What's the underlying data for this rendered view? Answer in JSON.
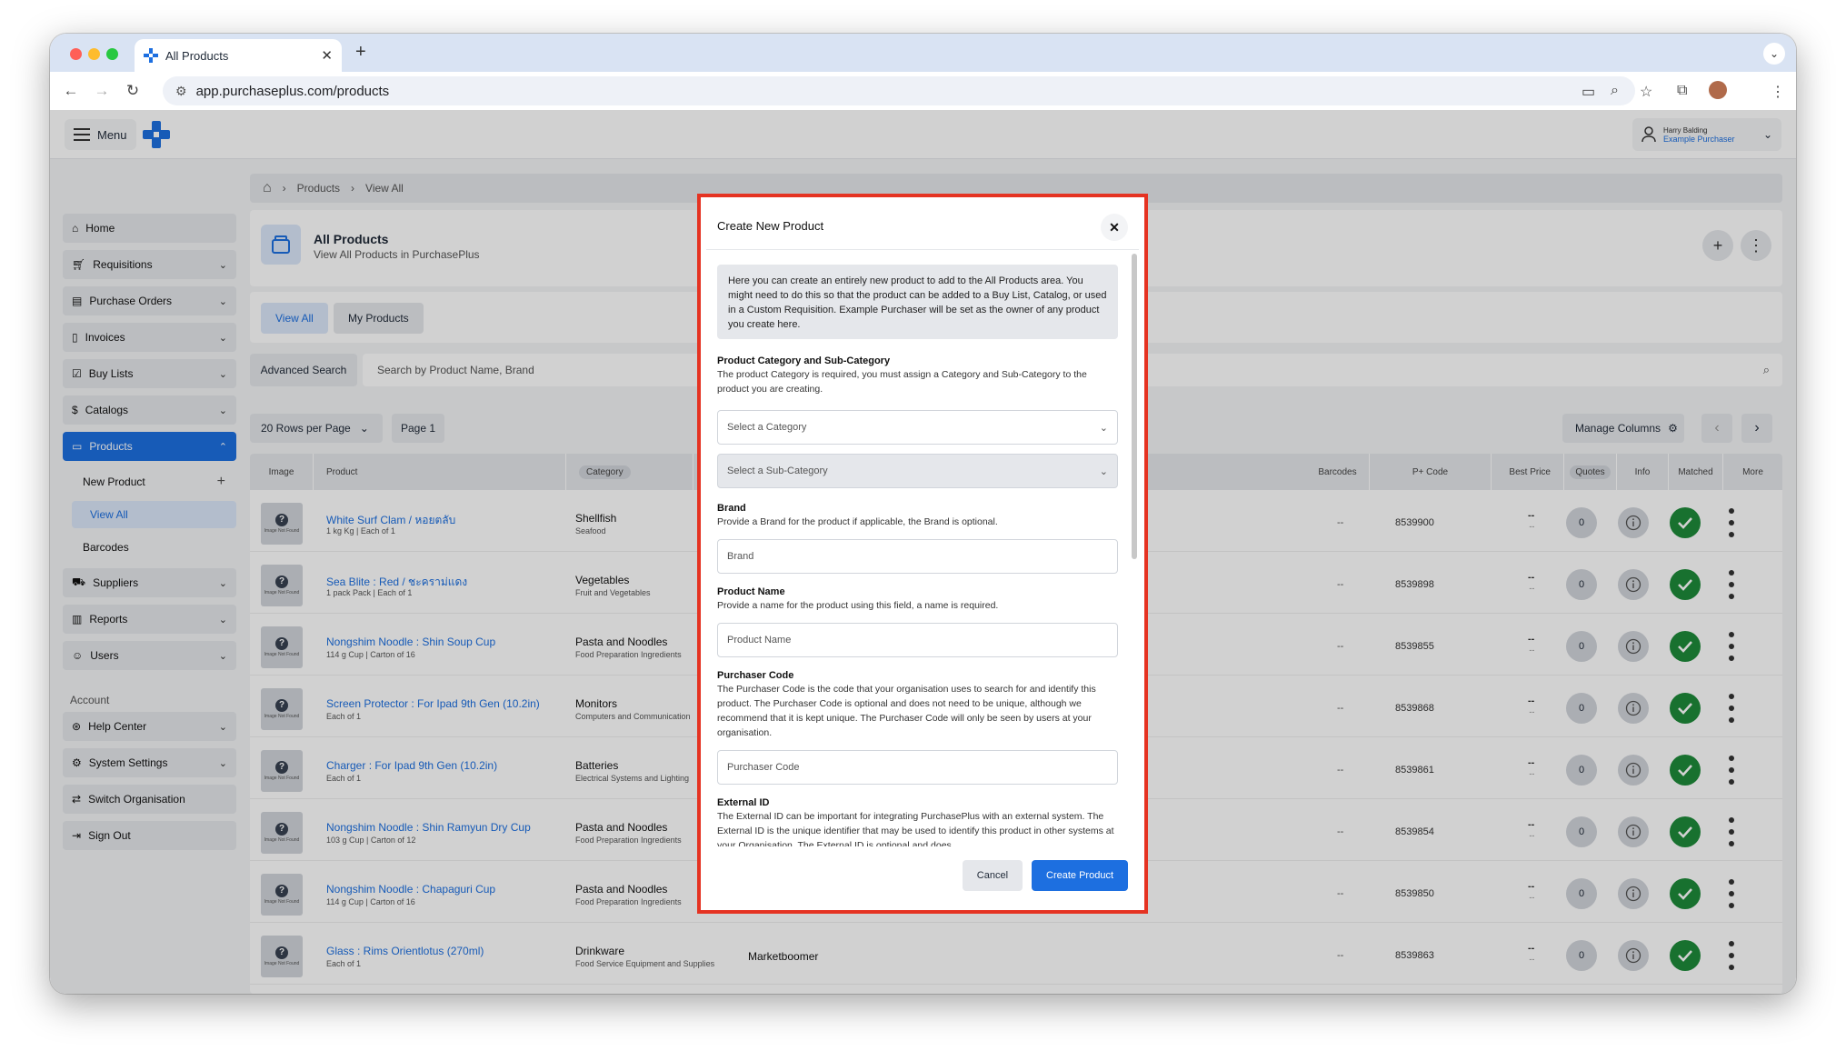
{
  "browser": {
    "tab_title": "All Products",
    "url": "app.purchaseplus.com/products"
  },
  "header": {
    "menu_label": "Menu",
    "user_name": "Harry Balding",
    "user_org": "Example Purchaser"
  },
  "sidebar": {
    "items": [
      {
        "label": "Home",
        "icon": "home-icon"
      },
      {
        "label": "Requisitions",
        "icon": "cart-icon"
      },
      {
        "label": "Purchase Orders",
        "icon": "clipboard-icon"
      },
      {
        "label": "Invoices",
        "icon": "document-icon"
      },
      {
        "label": "Buy Lists",
        "icon": "list-check-icon"
      },
      {
        "label": "Catalogs",
        "icon": "dollar-doc-icon"
      },
      {
        "label": "Products",
        "icon": "box-icon"
      }
    ],
    "product_sub": [
      "New Product",
      "View All",
      "Barcodes"
    ],
    "items_after": [
      {
        "label": "Suppliers",
        "icon": "truck-icon"
      },
      {
        "label": "Reports",
        "icon": "bar-chart-icon"
      },
      {
        "label": "Users",
        "icon": "user-icon"
      }
    ],
    "account_label": "Account",
    "account_items": [
      {
        "label": "Help Center",
        "icon": "lifebuoy-icon"
      },
      {
        "label": "System Settings",
        "icon": "gear-icon"
      },
      {
        "label": "Switch Organisation",
        "icon": "switch-icon"
      },
      {
        "label": "Sign Out",
        "icon": "sign-out-icon"
      }
    ]
  },
  "breadcrumb": [
    "Products",
    "View All"
  ],
  "page": {
    "title": "All Products",
    "subtitle": "View All Products in PurchasePlus"
  },
  "tabs": [
    "View All",
    "My Products"
  ],
  "search": {
    "advanced_label": "Advanced Search",
    "placeholder": "Search by Product Name, Brand"
  },
  "pagination": {
    "rows_label": "20 Rows per Page",
    "page_label": "Page 1",
    "manage_columns": "Manage Columns"
  },
  "table": {
    "columns": [
      "Image",
      "Product",
      "Category",
      "Barcodes",
      "P+ Code",
      "Best Price",
      "Quotes",
      "Info",
      "Matched",
      "More"
    ],
    "image_placeholder": "Image Not Found",
    "rows": [
      {
        "name": "White Surf Clam / หอยตลับ",
        "desc": "1 kg Kg | Each of 1",
        "category": "Shellfish",
        "subcategory": "Seafood",
        "owner": "",
        "barcodes": "--",
        "pcode": "8539900",
        "price": "--",
        "price_sub": "--",
        "quotes": "0"
      },
      {
        "name": "Sea Blite : Red / ชะคราม่แดง",
        "desc": "1 pack Pack | Each of 1",
        "category": "Vegetables",
        "subcategory": "Fruit and Vegetables",
        "owner": "",
        "barcodes": "--",
        "pcode": "8539898",
        "price": "--",
        "price_sub": "--",
        "quotes": "0"
      },
      {
        "name": "Nongshim Noodle : Shin Soup Cup",
        "desc": "114 g Cup | Carton of 16",
        "category": "Pasta and Noodles",
        "subcategory": "Food Preparation Ingredients",
        "owner": "",
        "barcodes": "--",
        "pcode": "8539855",
        "price": "--",
        "price_sub": "--",
        "quotes": "0"
      },
      {
        "name": "Screen Protector : For Ipad 9th Gen (10.2in)",
        "desc": "Each of 1",
        "category": "Monitors",
        "subcategory": "Computers and Communication",
        "owner": "",
        "barcodes": "--",
        "pcode": "8539868",
        "price": "--",
        "price_sub": "--",
        "quotes": "0"
      },
      {
        "name": "Charger : For Ipad 9th Gen (10.2in)",
        "desc": "Each of 1",
        "category": "Batteries",
        "subcategory": "Electrical Systems and Lighting",
        "owner": "",
        "barcodes": "--",
        "pcode": "8539861",
        "price": "--",
        "price_sub": "--",
        "quotes": "0"
      },
      {
        "name": "Nongshim Noodle : Shin Ramyun Dry Cup",
        "desc": "103 g Cup | Carton of 12",
        "category": "Pasta and Noodles",
        "subcategory": "Food Preparation Ingredients",
        "owner": "",
        "barcodes": "--",
        "pcode": "8539854",
        "price": "--",
        "price_sub": "--",
        "quotes": "0"
      },
      {
        "name": "Nongshim Noodle : Chapaguri Cup",
        "desc": "114 g Cup | Carton of 16",
        "category": "Pasta and Noodles",
        "subcategory": "Food Preparation Ingredients",
        "owner": "",
        "barcodes": "--",
        "pcode": "8539850",
        "price": "--",
        "price_sub": "--",
        "quotes": "0"
      },
      {
        "name": "Glass : Rims Orientlotus (270ml)",
        "desc": "Each of 1",
        "category": "Drinkware",
        "subcategory": "Food Service Equipment and Supplies",
        "owner": "Marketboomer",
        "barcodes": "--",
        "pcode": "8539863",
        "price": "--",
        "price_sub": "--",
        "quotes": "0"
      }
    ]
  },
  "modal": {
    "title": "Create New Product",
    "intro": "Here you can create an entirely new product to add to the All Products area. You might need to do this so that the product can be added to a Buy List, Catalog, or used in a Custom Requisition. Example Purchaser will be set as the owner of any product you create here.",
    "category_label": "Product Category and Sub-Category",
    "category_desc": "The product Category is required, you must assign a Category and Sub-Category to the product you are creating.",
    "category_placeholder": "Select a Category",
    "subcategory_placeholder": "Select a Sub-Category",
    "brand_label": "Brand",
    "brand_desc": "Provide a Brand for the product if applicable, the Brand is optional.",
    "brand_placeholder": "Brand",
    "name_label": "Product Name",
    "name_desc": "Provide a name for the product using this field, a name is required.",
    "name_placeholder": "Product Name",
    "pcode_label": "Purchaser Code",
    "pcode_desc": "The Purchaser Code is the code that your organisation uses to search for and identify this product. The Purchaser Code is optional and does not need to be unique, although we recommend that it is kept unique. The Purchaser Code will only be seen by users at your organisation.",
    "pcode_placeholder": "Purchaser Code",
    "extid_label": "External ID",
    "extid_desc": "The External ID can be important for integrating PurchasePlus with an external system. The External ID is the unique identifier that may be used to identify this product in other systems at your Organisation. The External ID is optional and does",
    "cancel_label": "Cancel",
    "create_label": "Create Product"
  }
}
